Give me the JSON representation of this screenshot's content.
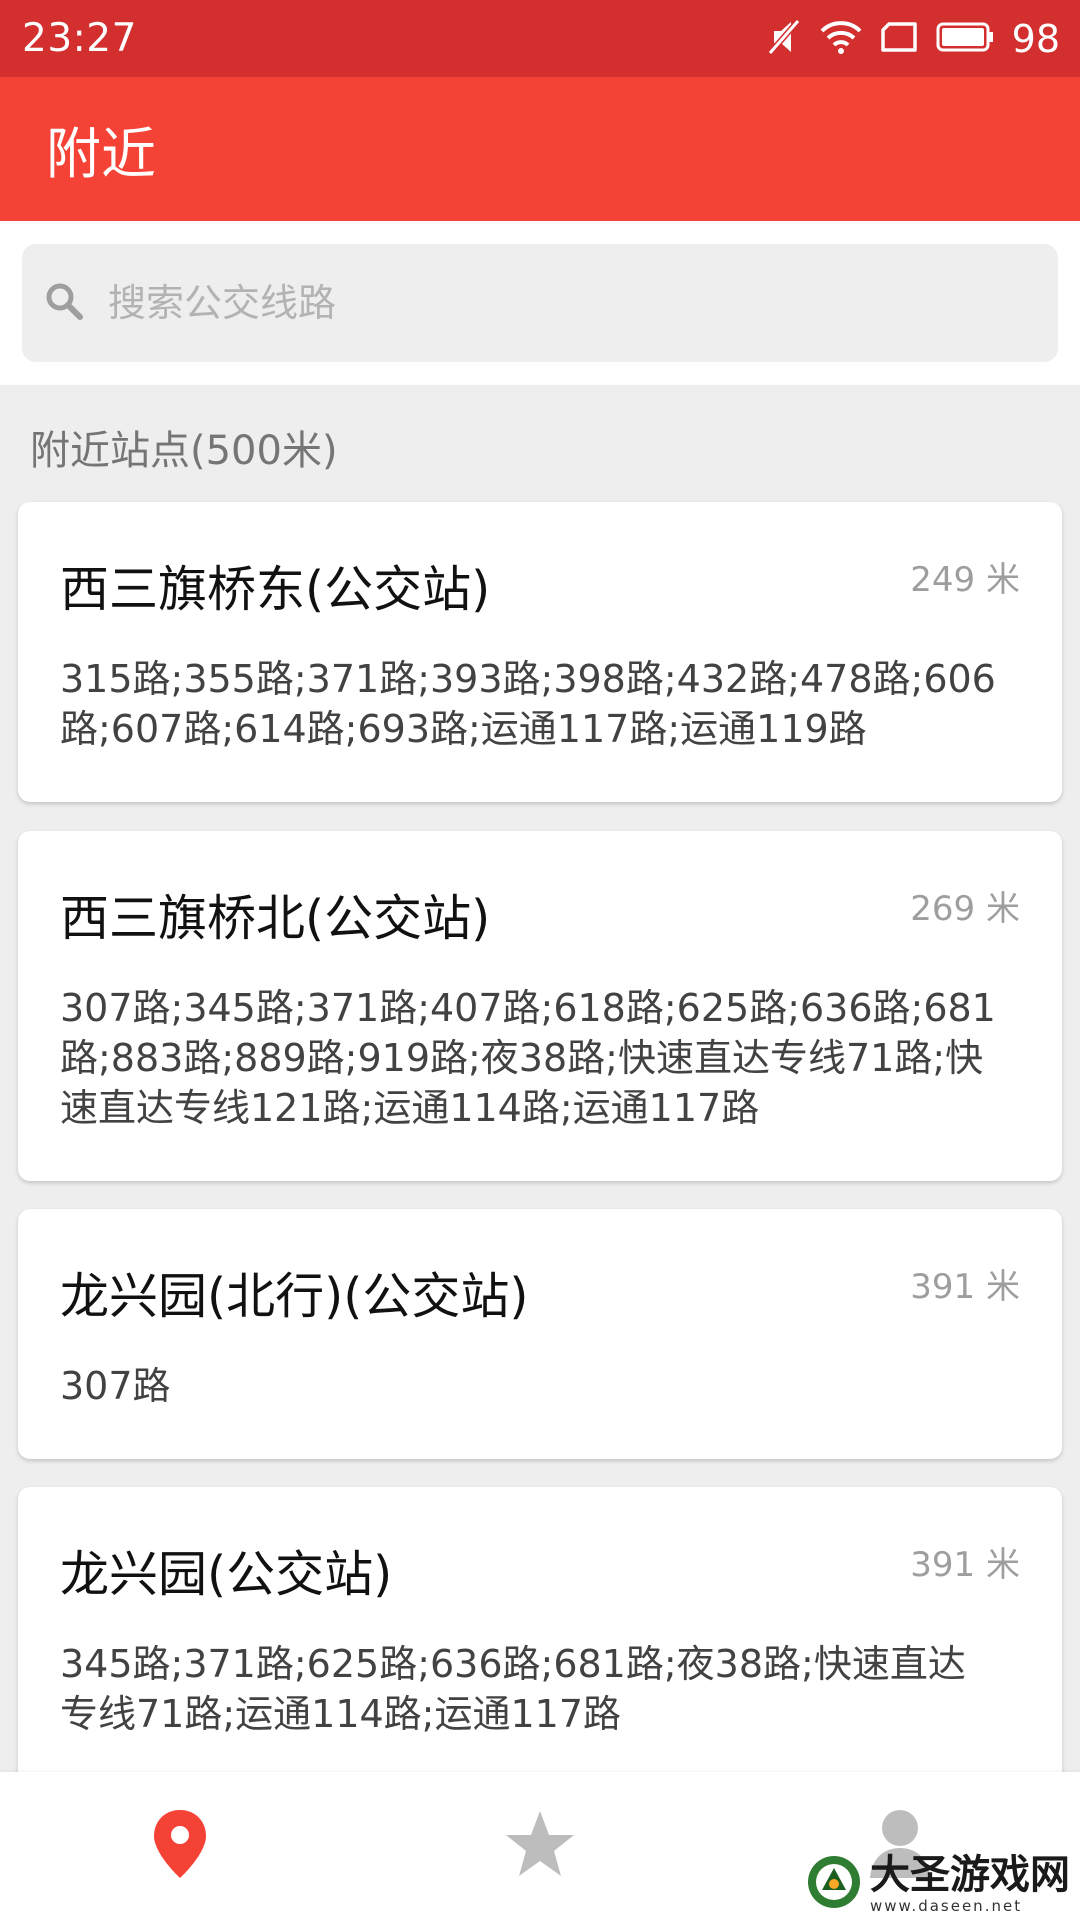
{
  "status_bar": {
    "time": "23:27",
    "battery": "98",
    "icons": [
      "mute-icon",
      "wifi-icon",
      "sim-icon",
      "battery-icon"
    ]
  },
  "app_bar": {
    "title": "附近"
  },
  "search": {
    "placeholder": "搜索公交线路",
    "value": ""
  },
  "section": {
    "title": "附近站点(500米)"
  },
  "stations": [
    {
      "name": "西三旗桥东(公交站)",
      "distance": "249 米",
      "lines": "315路;355路;371路;393路;398路;432路;478路;606路;607路;614路;693路;运通117路;运通119路"
    },
    {
      "name": "西三旗桥北(公交站)",
      "distance": "269 米",
      "lines": "307路;345路;371路;407路;618路;625路;636路;681路;883路;889路;919路;夜38路;快速直达专线71路;快速直达专线121路;运通114路;运通117路"
    },
    {
      "name": "龙兴园(北行)(公交站)",
      "distance": "391 米",
      "lines": "307路"
    },
    {
      "name": "龙兴园(公交站)",
      "distance": "391 米",
      "lines": "345路;371路;625路;636路;681路;夜38路;快速直达专线71路;运通114路;运通117路"
    }
  ],
  "bottom_nav": {
    "items": [
      {
        "icon": "location-pin-icon",
        "active": true
      },
      {
        "icon": "star-icon",
        "active": false
      },
      {
        "icon": "person-icon",
        "active": false
      }
    ]
  },
  "watermark": {
    "text": "大圣游戏网",
    "url": "www.daseen.net"
  },
  "colors": {
    "status_bar": "#d32f2f",
    "app_bar": "#f44336",
    "active_icon": "#f44336",
    "inactive_icon": "#bdbdbd"
  }
}
